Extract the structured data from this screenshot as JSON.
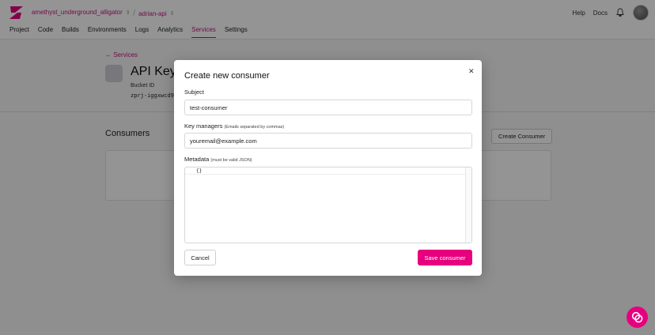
{
  "topbar": {
    "org": "amethyst_underground_alligator",
    "project": "adrian-api",
    "help": "Help",
    "docs": "Docs"
  },
  "nav": {
    "items": [
      "Project",
      "Code",
      "Builds",
      "Environments",
      "Logs",
      "Analytics",
      "Services",
      "Settings"
    ],
    "active": "Services"
  },
  "page": {
    "back_link": "← Services",
    "title": "API Key",
    "bucket_label": "Bucket ID",
    "bucket_value": "zprj-iggxwcd9",
    "consumers_heading": "Consumers",
    "create_consumer": "Create Consumer"
  },
  "modal": {
    "title": "Create new consumer",
    "subject_label": "Subject",
    "subject_value": "test-consumer",
    "key_managers_label": "Key managers",
    "key_managers_hint": "(Emails separated by commas)",
    "key_managers_value": "youremail@example.com",
    "metadata_label": "Metadata",
    "metadata_hint": "(must be valid JSON)",
    "metadata_value": "{}",
    "cancel": "Cancel",
    "save": "Save consumer"
  },
  "colors": {
    "accent": "#e6007e",
    "link": "#c2187f"
  }
}
